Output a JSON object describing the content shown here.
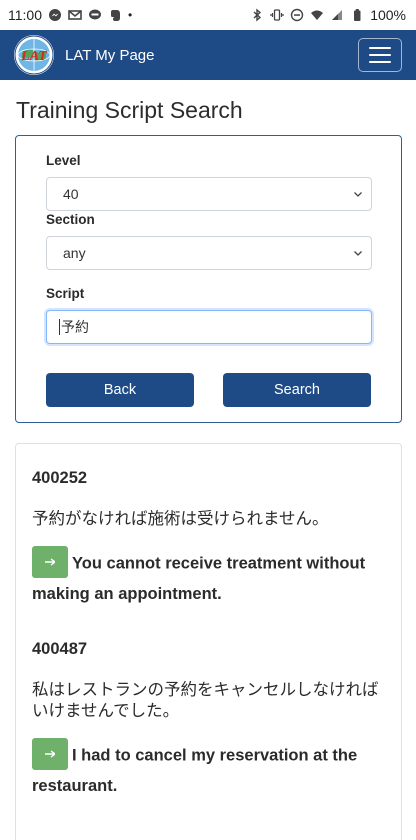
{
  "status_bar": {
    "time": "11:00",
    "left_icons": [
      "messenger-icon",
      "gmail-icon",
      "line-icon",
      "evernote-icon"
    ],
    "dot": "•",
    "right_icons": [
      "bluetooth-icon",
      "vibrate-icon",
      "do-not-disturb-icon",
      "wifi-icon",
      "signal-icon",
      "battery-icon"
    ],
    "battery": "100%"
  },
  "navbar": {
    "logo_text": "LAT",
    "title": "LAT My Page",
    "menu_icon": "hamburger-menu-icon",
    "color": "#1e4b86"
  },
  "page": {
    "title": "Training Script Search"
  },
  "search_form": {
    "level_label": "Level",
    "level_value": "40",
    "section_label": "Section",
    "section_value": "any",
    "script_label": "Script",
    "script_value": "予約",
    "back_label": "Back",
    "search_label": "Search",
    "accent_color": "#1e4b86"
  },
  "results": [
    {
      "id": "400252",
      "japanese": "予約がなければ施術は受けられません。",
      "english": "You cannot receive treatment without making an appointment.",
      "play_icon": "play-icon"
    },
    {
      "id": "400487",
      "japanese": "私はレストランの予約をキャンセルしなければいけませんでした。",
      "english": "I had to cancel my reservation at the restaurant.",
      "play_icon": "play-icon"
    }
  ],
  "colors": {
    "play_button": "#6fb16a"
  }
}
